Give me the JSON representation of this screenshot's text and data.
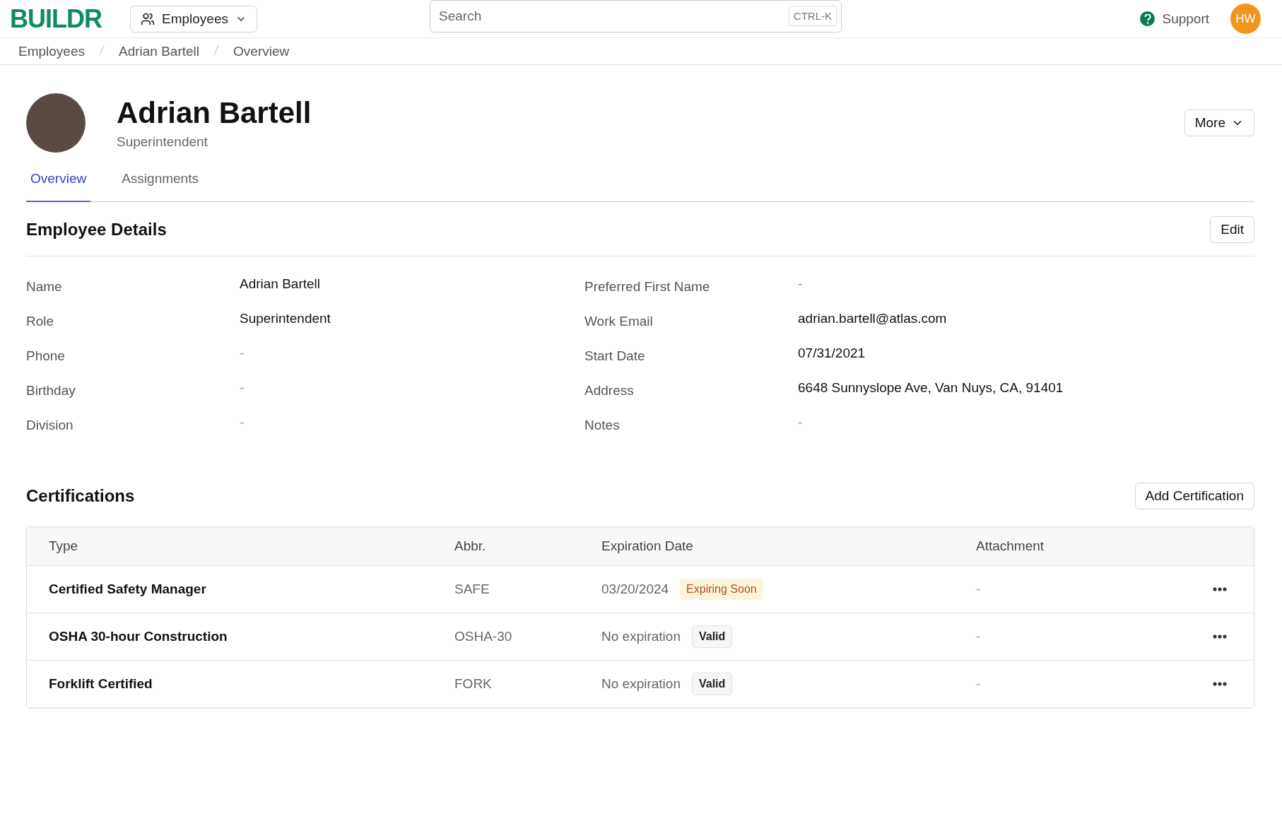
{
  "topbar": {
    "logo": "BUILDR",
    "module": "Employees",
    "search": {
      "placeholder": "Search",
      "shortcut": "CTRL-K"
    },
    "support": "Support",
    "user_initials": "HW"
  },
  "breadcrumbs": [
    "Employees",
    "Adrian Bartell",
    "Overview"
  ],
  "profile": {
    "name": "Adrian Bartell",
    "role": "Superintendent",
    "more": "More"
  },
  "tabs": [
    {
      "label": "Overview",
      "selected": true
    },
    {
      "label": "Assignments",
      "selected": false
    }
  ],
  "details": {
    "title": "Employee Details",
    "edit": "Edit",
    "left": [
      {
        "label": "Name",
        "value": "Adrian Bartell"
      },
      {
        "label": "Role",
        "value": "Superintendent"
      },
      {
        "label": "Phone",
        "value": "-",
        "kind": "empty"
      },
      {
        "label": "Birthday",
        "value": "-",
        "kind": "empty"
      },
      {
        "label": "Division",
        "value": "-",
        "kind": "empty"
      }
    ],
    "right": [
      {
        "label": "Preferred First Name",
        "value": "-",
        "kind": "empty"
      },
      {
        "label": "Work Email",
        "value": "adrian.bartell@atlas.com"
      },
      {
        "label": "Start Date",
        "value": "07/31/2021"
      },
      {
        "label": "Address",
        "value": "6648 Sunnyslope Ave, Van Nuys, CA, 91401"
      },
      {
        "label": "Notes",
        "value": "-",
        "kind": "empty"
      }
    ]
  },
  "certifications": {
    "title": "Certifications",
    "add": "Add Certification",
    "columns": [
      "Type",
      "Abbr.",
      "Expiration Date",
      "Attachment"
    ],
    "rows": [
      {
        "type": "Certified Safety Manager",
        "abbr": "SAFE",
        "expiration": "03/20/2024",
        "badge": {
          "label": "Expiring Soon",
          "kind": "warning"
        },
        "attachment": "-"
      },
      {
        "type": "OSHA 30-hour Construction",
        "abbr": "OSHA-30",
        "expiration": "No expiration",
        "badge": {
          "label": "Valid",
          "kind": "neutral"
        },
        "attachment": "-"
      },
      {
        "type": "Forklift Certified",
        "abbr": "FORK",
        "expiration": "No expiration",
        "badge": {
          "label": "Valid",
          "kind": "neutral"
        },
        "attachment": "-"
      }
    ]
  }
}
